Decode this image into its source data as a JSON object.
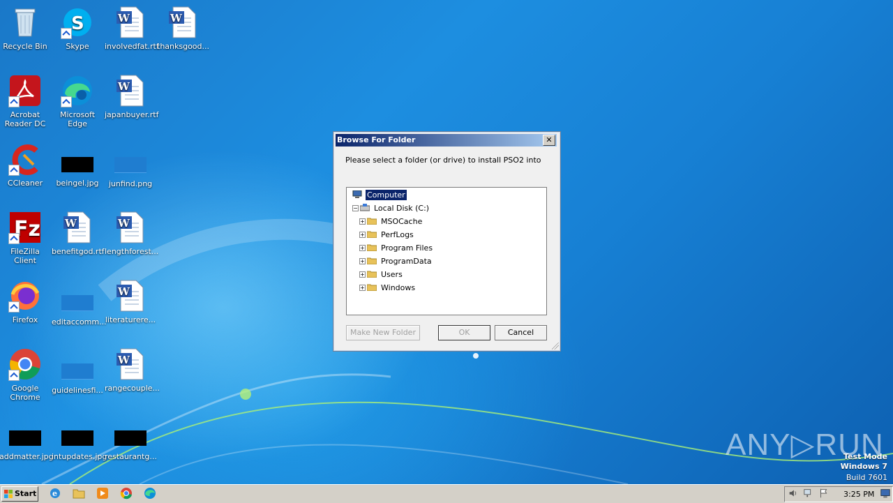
{
  "desktop_icons": [
    {
      "label": "Recycle Bin",
      "icon": "recycle-bin-icon"
    },
    {
      "label": "Skype",
      "icon": "skype-icon"
    },
    {
      "label": "involvedfat.rtf",
      "icon": "word-doc-icon"
    },
    {
      "label": "thanksgood...",
      "icon": "word-doc-icon"
    },
    {
      "label": "Acrobat Reader DC",
      "icon": "acrobat-icon"
    },
    {
      "label": "Microsoft Edge",
      "icon": "edge-icon"
    },
    {
      "label": "japanbuyer.rtf",
      "icon": "word-doc-icon"
    },
    {
      "label": "CCleaner",
      "icon": "ccleaner-icon"
    },
    {
      "label": "beingel.jpg",
      "icon": "image-thumb-icon"
    },
    {
      "label": "junfind.png",
      "icon": "image-thumb-icon"
    },
    {
      "label": "FileZilla Client",
      "icon": "filezilla-icon"
    },
    {
      "label": "benefitgod.rtf",
      "icon": "word-doc-icon"
    },
    {
      "label": "lengthforest...",
      "icon": "word-doc-icon"
    },
    {
      "label": "Firefox",
      "icon": "firefox-icon"
    },
    {
      "label": "editaccomm...",
      "icon": "image-thumb-icon"
    },
    {
      "label": "literaturere...",
      "icon": "word-doc-icon"
    },
    {
      "label": "Google Chrome",
      "icon": "chrome-icon"
    },
    {
      "label": "guidelinesfi...",
      "icon": "image-thumb-icon"
    },
    {
      "label": "rangecouple...",
      "icon": "word-doc-icon"
    },
    {
      "label": "addmatter.jpg",
      "icon": "image-thumb-icon"
    },
    {
      "label": "intupdates.jpg",
      "icon": "image-thumb-icon"
    },
    {
      "label": "restaurantg...",
      "icon": "image-thumb-icon"
    }
  ],
  "dialog": {
    "title": "Browse For Folder",
    "close_label": "✕",
    "prompt": "Please select a folder (or drive) to install PSO2 into",
    "tree": {
      "root": "Computer",
      "drive": "Local Disk (C:)",
      "folders": [
        "MSOCache",
        "PerfLogs",
        "Program Files",
        "ProgramData",
        "Users",
        "Windows"
      ]
    },
    "buttons": {
      "new_folder": "Make New Folder",
      "ok": "OK",
      "cancel": "Cancel"
    }
  },
  "taskbar": {
    "start_label": "Start",
    "clock": "3:25 PM"
  },
  "watermark": {
    "line1": "Test Mode",
    "line2": "Windows 7",
    "line3": "Build 7601",
    "brand": "ANY▷RUN"
  }
}
